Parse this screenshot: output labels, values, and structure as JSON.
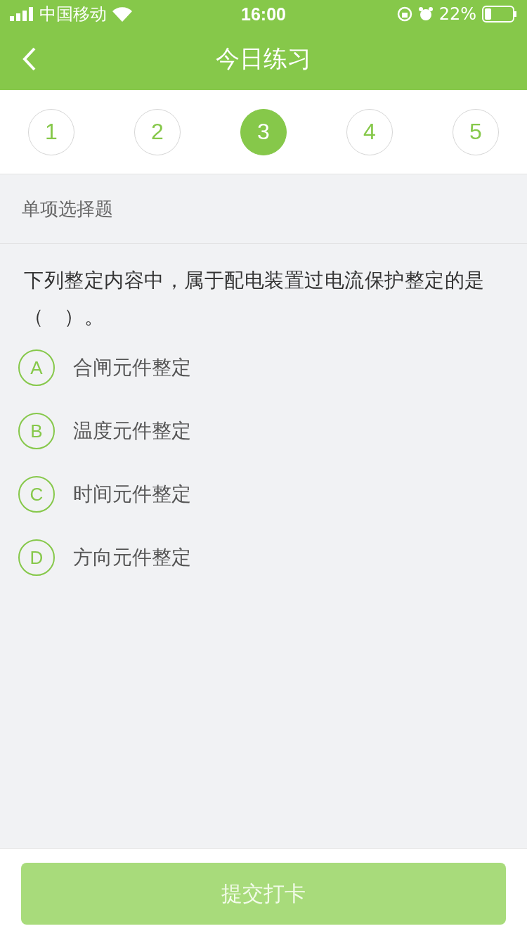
{
  "status_bar": {
    "carrier": "中国移动",
    "time": "16:00",
    "battery": "22%"
  },
  "nav": {
    "title": "今日练习"
  },
  "steps": [
    {
      "label": "1",
      "selected": false
    },
    {
      "label": "2",
      "selected": false
    },
    {
      "label": "3",
      "selected": true
    },
    {
      "label": "4",
      "selected": false
    },
    {
      "label": "5",
      "selected": false
    }
  ],
  "section_title": "单项选择题",
  "question": {
    "text": "下列整定内容中，属于配电装置过电流保护整定的是（　）。",
    "options": [
      {
        "letter": "A",
        "text": "合闸元件整定",
        "selected": false
      },
      {
        "letter": "B",
        "text": "温度元件整定",
        "selected": false
      },
      {
        "letter": "C",
        "text": "时间元件整定",
        "selected": false
      },
      {
        "letter": "D",
        "text": "方向元件整定",
        "selected": false
      }
    ]
  },
  "submit_button": {
    "label": "提交打卡",
    "disabled": true
  }
}
